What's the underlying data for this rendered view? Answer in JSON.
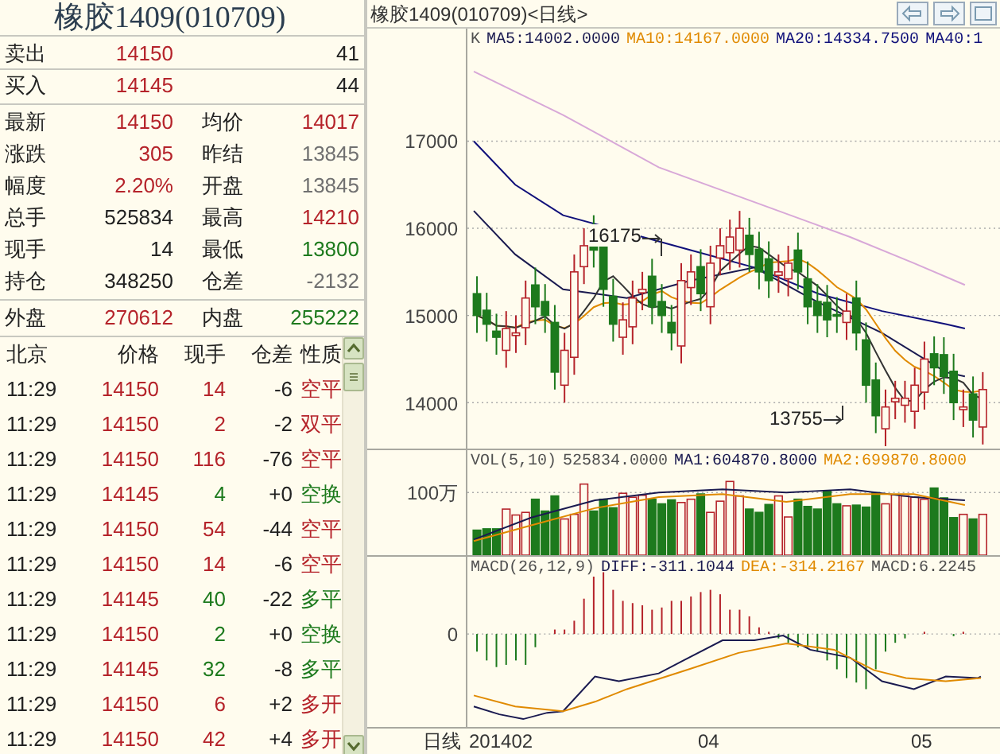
{
  "title": "橡胶1409(010709)",
  "orders": [
    {
      "label": "卖出",
      "price": "14150",
      "color": "#b5232a",
      "volume": "41"
    },
    {
      "label": "买入",
      "price": "14145",
      "color": "#b5232a",
      "volume": "44"
    }
  ],
  "stats": [
    {
      "left": {
        "label": "最新",
        "value": "14150",
        "color": "#b5232a"
      },
      "right": {
        "label": "均价",
        "value": "14017",
        "color": "#b5232a"
      }
    },
    {
      "left": {
        "label": "涨跌",
        "value": "305",
        "color": "#b5232a"
      },
      "right": {
        "label": "昨结",
        "value": "13845",
        "color": "#707070"
      }
    },
    {
      "left": {
        "label": "幅度",
        "value": "2.20%",
        "color": "#b5232a"
      },
      "right": {
        "label": "开盘",
        "value": "13845",
        "color": "#707070"
      }
    },
    {
      "left": {
        "label": "总手",
        "value": "525834",
        "color": "#222222"
      },
      "right": {
        "label": "最高",
        "value": "14210",
        "color": "#b5232a"
      }
    },
    {
      "left": {
        "label": "现手",
        "value": "14",
        "color": "#222222"
      },
      "right": {
        "label": "最低",
        "value": "13800",
        "color": "#1d7a1d"
      }
    },
    {
      "left": {
        "label": "持仓",
        "value": "348250",
        "color": "#222222"
      },
      "right": {
        "label": "仓差",
        "value": "-2132",
        "color": "#707070"
      }
    }
  ],
  "outer_inner": {
    "left": {
      "label": "外盘",
      "value": "270612",
      "color": "#b5232a"
    },
    "right": {
      "label": "内盘",
      "value": "255222",
      "color": "#1d7a1d"
    }
  },
  "ticks_header": [
    "北京",
    "价格",
    "现手",
    "仓差",
    "性质"
  ],
  "ticks": [
    {
      "time": "11:29",
      "price": "14150",
      "volume": "14",
      "oi_change": "-6",
      "nature": "空平",
      "color": "#b5232a"
    },
    {
      "time": "11:29",
      "price": "14150",
      "volume": "2",
      "oi_change": "-2",
      "nature": "双平",
      "color": "#b5232a"
    },
    {
      "time": "11:29",
      "price": "14150",
      "volume": "116",
      "oi_change": "-76",
      "nature": "空平",
      "color": "#b5232a"
    },
    {
      "time": "11:29",
      "price": "14145",
      "volume": "4",
      "oi_change": "+0",
      "nature": "空换",
      "color": "#1d7a1d"
    },
    {
      "time": "11:29",
      "price": "14150",
      "volume": "54",
      "oi_change": "-44",
      "nature": "空平",
      "color": "#b5232a"
    },
    {
      "time": "11:29",
      "price": "14150",
      "volume": "14",
      "oi_change": "-6",
      "nature": "空平",
      "color": "#b5232a"
    },
    {
      "time": "11:29",
      "price": "14145",
      "volume": "40",
      "oi_change": "-22",
      "nature": "多平",
      "color": "#1d7a1d"
    },
    {
      "time": "11:29",
      "price": "14150",
      "volume": "2",
      "oi_change": "+0",
      "nature": "空换",
      "color": "#1d7a1d"
    },
    {
      "time": "11:29",
      "price": "14145",
      "volume": "32",
      "oi_change": "-8",
      "nature": "多平",
      "color": "#1d7a1d"
    },
    {
      "time": "11:29",
      "price": "14150",
      "volume": "6",
      "oi_change": "+2",
      "nature": "多开",
      "color": "#b5232a"
    },
    {
      "time": "11:29",
      "price": "14150",
      "volume": "42",
      "oi_change": "+4",
      "nature": "多开",
      "color": "#b5232a"
    }
  ],
  "chart": {
    "title": "橡胶1409(010709)<日线>",
    "price_panel": {
      "legend": [
        {
          "text": "K",
          "color": "#505050"
        },
        {
          "text": "MA5:14002.0000",
          "color": "#1a1a50"
        },
        {
          "text": "MA10:14167.0000",
          "color": "#e08a00"
        },
        {
          "text": "MA20:14334.7500",
          "color": "#10107a"
        },
        {
          "text": "MA40:1",
          "color": "#10107a"
        }
      ],
      "y_labels": [
        "17000",
        "16000",
        "15000",
        "14000"
      ],
      "annotations": [
        "16175",
        "13755"
      ]
    },
    "volume_panel": {
      "legend": [
        {
          "text": "VOL(5,10)",
          "color": "#505050"
        },
        {
          "text": "525834.0000",
          "color": "#505050"
        },
        {
          "text": "MA1:604870.8000",
          "color": "#1a1a50"
        },
        {
          "text": "MA2:699870.8000",
          "color": "#e08a00"
        }
      ],
      "y_labels": [
        "100万"
      ]
    },
    "macd_panel": {
      "legend": [
        {
          "text": "MACD(26,12,9)",
          "color": "#505050"
        },
        {
          "text": "DIFF:-311.1044",
          "color": "#1a1a50"
        },
        {
          "text": "DEA:-314.2167",
          "color": "#e08a00"
        },
        {
          "text": "MACD:6.2245",
          "color": "#505050"
        }
      ],
      "y_labels": [
        "0"
      ]
    },
    "period_label": "日线",
    "x_labels": [
      "201402",
      "04",
      "05"
    ]
  }
}
